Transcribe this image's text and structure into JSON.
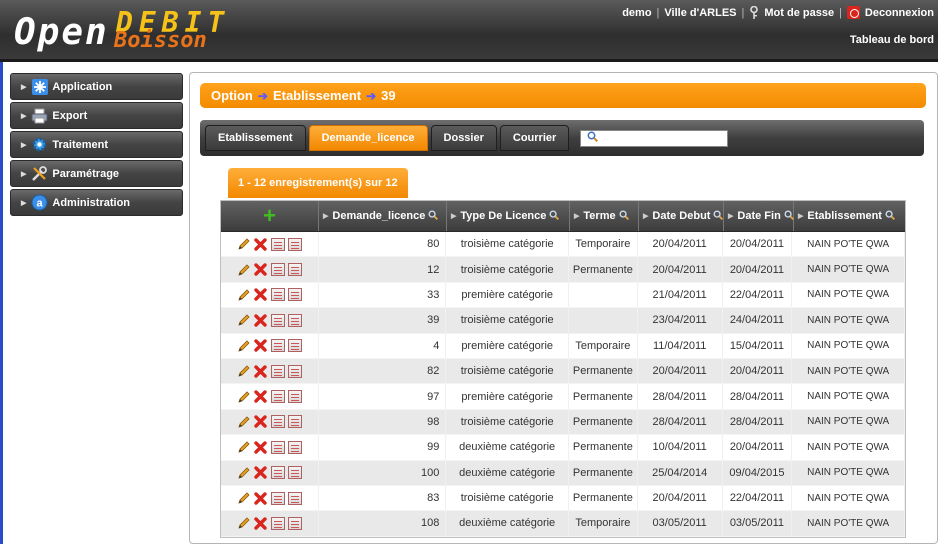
{
  "header": {
    "logo_open": "Open",
    "logo_debit": "DEBIT",
    "logo_boisson": "Boisson",
    "user": "demo",
    "city": "Ville d'ARLES",
    "password_link": "Mot de passe",
    "logout_link": "Deconnexion",
    "dashboard_link": "Tableau de bord"
  },
  "sidebar": {
    "items": [
      {
        "label": "Application",
        "icon": "asterisk-icon"
      },
      {
        "label": "Export",
        "icon": "printer-icon"
      },
      {
        "label": "Traitement",
        "icon": "gear-icon"
      },
      {
        "label": "Paramétrage",
        "icon": "tools-icon"
      },
      {
        "label": "Administration",
        "icon": "admin-icon"
      }
    ]
  },
  "breadcrumb": {
    "items": [
      "Option",
      "Etablissement",
      "39"
    ]
  },
  "tabs": [
    {
      "label": "Etablissement",
      "active": false
    },
    {
      "label": "Demande_licence",
      "active": true
    },
    {
      "label": "Dossier",
      "active": false
    },
    {
      "label": "Courrier",
      "active": false
    }
  ],
  "search": {
    "value": ""
  },
  "records_label": "1 - 12 enregistrement(s) sur 12",
  "table": {
    "columns": [
      "Demande_licence",
      "Type De Licence",
      "Terme",
      "Date Debut",
      "Date Fin",
      "Etablissement"
    ],
    "rows": [
      [
        "80",
        "troisième catégorie",
        "Temporaire",
        "20/04/2011",
        "20/04/2011",
        "NAIN PO'TE QWA"
      ],
      [
        "12",
        "troisième catégorie",
        "Permanente",
        "20/04/2011",
        "20/04/2011",
        "NAIN PO'TE QWA"
      ],
      [
        "33",
        "première catégorie",
        "",
        "21/04/2011",
        "22/04/2011",
        "NAIN PO'TE QWA"
      ],
      [
        "39",
        "troisième catégorie",
        "",
        "23/04/2011",
        "24/04/2011",
        "NAIN PO'TE QWA"
      ],
      [
        "4",
        "première catégorie",
        "Temporaire",
        "11/04/2011",
        "15/04/2011",
        "NAIN PO'TE QWA"
      ],
      [
        "82",
        "troisième catégorie",
        "Permanente",
        "20/04/2011",
        "20/04/2011",
        "NAIN PO'TE QWA"
      ],
      [
        "97",
        "première catégorie",
        "Permanente",
        "28/04/2011",
        "28/04/2011",
        "NAIN PO'TE QWA"
      ],
      [
        "98",
        "troisième catégorie",
        "Permanente",
        "28/04/2011",
        "28/04/2011",
        "NAIN PO'TE QWA"
      ],
      [
        "99",
        "deuxième catégorie",
        "Permanente",
        "10/04/2011",
        "20/04/2011",
        "NAIN PO'TE QWA"
      ],
      [
        "100",
        "deuxième catégorie",
        "Permanente",
        "25/04/2014",
        "09/04/2015",
        "NAIN PO'TE QWA"
      ],
      [
        "83",
        "troisième catégorie",
        "Permanente",
        "20/04/2011",
        "22/04/2011",
        "NAIN PO'TE QWA"
      ],
      [
        "108",
        "deuxième catégorie",
        "Temporaire",
        "03/05/2011",
        "03/05/2011",
        "NAIN PO'TE QWA"
      ]
    ]
  },
  "colors": {
    "accent": "#f38b00",
    "header_dark": "#3a3a3a",
    "add_green": "#3fbf1f",
    "delete_red": "#d9251d"
  }
}
